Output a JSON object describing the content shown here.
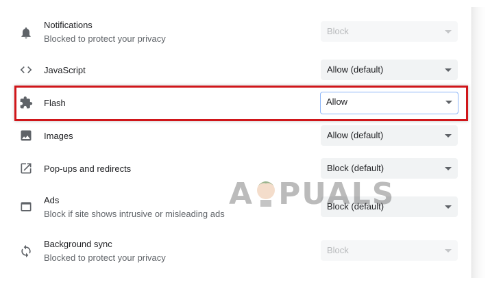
{
  "settings": [
    {
      "id": "notifications",
      "icon": "bell-icon",
      "title": "Notifications",
      "subtitle": "Blocked to protect your privacy",
      "value": "Block",
      "disabled": true
    },
    {
      "id": "javascript",
      "icon": "code-icon",
      "title": "JavaScript",
      "subtitle": "",
      "value": "Allow (default)",
      "disabled": false
    },
    {
      "id": "flash",
      "icon": "puzzle-icon",
      "title": "Flash",
      "subtitle": "",
      "value": "Allow",
      "disabled": false,
      "highlighted": true
    },
    {
      "id": "images",
      "icon": "image-icon",
      "title": "Images",
      "subtitle": "",
      "value": "Allow (default)",
      "disabled": false
    },
    {
      "id": "popups",
      "icon": "open-in-new-icon",
      "title": "Pop-ups and redirects",
      "subtitle": "",
      "value": "Block (default)",
      "disabled": false
    },
    {
      "id": "ads",
      "icon": "window-icon",
      "title": "Ads",
      "subtitle": "Block if site shows intrusive or misleading ads",
      "value": "Block (default)",
      "disabled": false
    },
    {
      "id": "background_sync",
      "icon": "sync-icon",
      "title": "Background sync",
      "subtitle": "Blocked to protect your privacy",
      "value": "Block",
      "disabled": true
    }
  ],
  "watermark": "APPUALS",
  "colors": {
    "highlight_border": "#d0161a",
    "focus_border": "#8ab4f8",
    "select_bg": "#f1f3f4"
  }
}
